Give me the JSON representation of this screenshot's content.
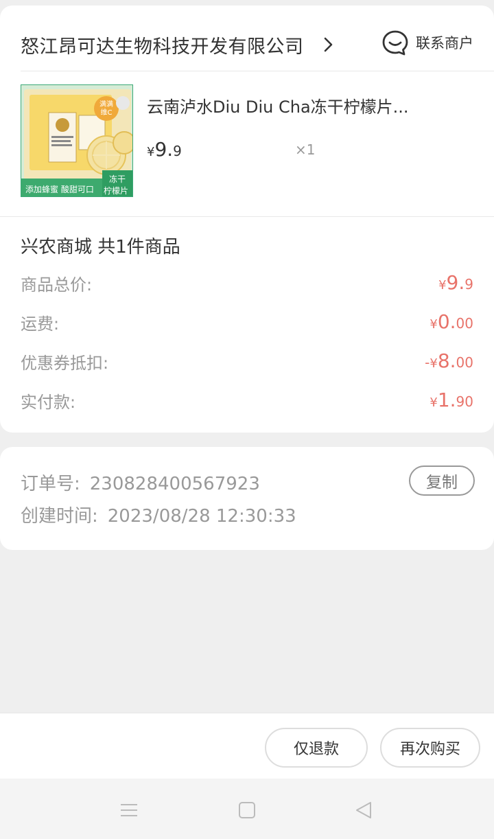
{
  "shop": {
    "name": "怒江昂可达生物科技开发有限公司",
    "contact_label": "联系商户"
  },
  "product": {
    "title": "云南泸水Diu Diu Cha冻干柠檬片...",
    "price_symbol": "¥",
    "price_int": "9.",
    "price_dec": "9",
    "quantity": "×1",
    "image_text": {
      "badge": "满满维C",
      "banner_left": "添加蜂蜜 酸甜可口",
      "banner_right_1": "冻干",
      "banner_right_2": "柠檬片"
    }
  },
  "summary": {
    "title": "兴农商城 共1件商品",
    "rows": [
      {
        "label": "商品总价:",
        "sign": "",
        "symbol": "¥",
        "int": "9.",
        "dec": "9"
      },
      {
        "label": "运费:",
        "sign": "",
        "symbol": "¥",
        "int": "0.",
        "dec": "00"
      },
      {
        "label": "优惠券抵扣:",
        "sign": "-",
        "symbol": "¥",
        "int": "8.",
        "dec": "00"
      },
      {
        "label": "实付款:",
        "sign": "",
        "symbol": "¥",
        "int": "1.",
        "dec": "90"
      }
    ]
  },
  "order": {
    "number_label": "订单号:",
    "number": "230828400567923",
    "time_label": "创建时间:",
    "time": "2023/08/28 12:30:33",
    "copy_label": "复制"
  },
  "actions": {
    "refund_label": "仅退款",
    "rebuy_label": "再次购买"
  },
  "colors": {
    "accent": "#e8736a",
    "muted": "#999999",
    "text": "#333333",
    "background": "#efefef"
  },
  "icons": {
    "chevron": "chevron-right-icon",
    "contact": "chat-bubble-icon",
    "nav_menu": "menu-icon",
    "nav_home": "square-icon",
    "nav_back": "triangle-back-icon"
  }
}
